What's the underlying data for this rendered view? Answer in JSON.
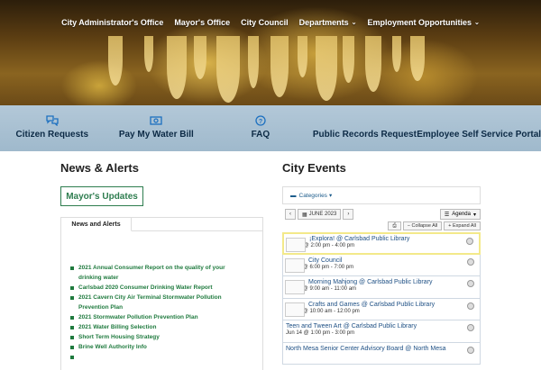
{
  "nav": {
    "items": [
      {
        "label": "City Administrator's Office",
        "dropdown": false
      },
      {
        "label": "Mayor's Office",
        "dropdown": false
      },
      {
        "label": "City Council",
        "dropdown": false
      },
      {
        "label": "Departments",
        "dropdown": true
      },
      {
        "label": "Employment Opportunities",
        "dropdown": true
      }
    ]
  },
  "quicklinks": [
    {
      "label": "Citizen Requests",
      "icon": "chat-bubbles-icon"
    },
    {
      "label": "Pay My Water Bill",
      "icon": "money-icon"
    },
    {
      "label": "FAQ",
      "icon": "question-circle-icon"
    },
    {
      "label": "Public Records Request",
      "icon": ""
    },
    {
      "label": "Employee Self Service Portal",
      "icon": ""
    }
  ],
  "news": {
    "heading": "News & Alerts",
    "mayor_button": "Mayor's Updates",
    "tab": "News and Alerts",
    "items": [
      "2021 Annual Consumer Report on the quality of your drinking water",
      "Carlsbad 2020 Consumer Drinking Water Report",
      "2021 Cavern City Air Terminal Stormwater Pollution Prevention Plan",
      "2021 Stormwater Pollution Prevention Plan",
      "2021 Water Billing Selection",
      "Short Term Housing Strategy",
      "Brine Well Authority Info",
      ""
    ]
  },
  "events": {
    "heading": "City Events",
    "categories_label": "Categories",
    "month": "JUNE 2023",
    "view": "Agenda",
    "collapse": "Collapse All",
    "expand": "Expand All",
    "list": [
      {
        "title": "¡Explora! @ Carlsbad Public Library",
        "time": "Jun 13 @ 2:00 pm - 4:00 pm",
        "thumb": true
      },
      {
        "title": "City Council",
        "time": "Jun 13 @ 6:00 pm - 7:00 pm",
        "thumb": true
      },
      {
        "title": "Morning Mahjong @ Carlsbad Public Library",
        "time": "Jun 14 @ 9:00 am - 11:00 am",
        "thumb": true
      },
      {
        "title": "Crafts and Games @ Carlsbad Public Library",
        "time": "Jun 14 @ 10:00 am - 12:00 pm",
        "thumb": true
      },
      {
        "title": "Teen and Tween Art @ Carlsbad Public Library",
        "time": "Jun 14 @ 1:00 pm - 3:00 pm",
        "thumb": false
      },
      {
        "title": "North Mesa Senior Center Advisory Board @ North Mesa",
        "time": "",
        "thumb": false
      }
    ]
  },
  "colors": {
    "accent_green": "#1f7a3e",
    "accent_blue": "#1c70c0",
    "quickbar": "#a9c1d3"
  }
}
